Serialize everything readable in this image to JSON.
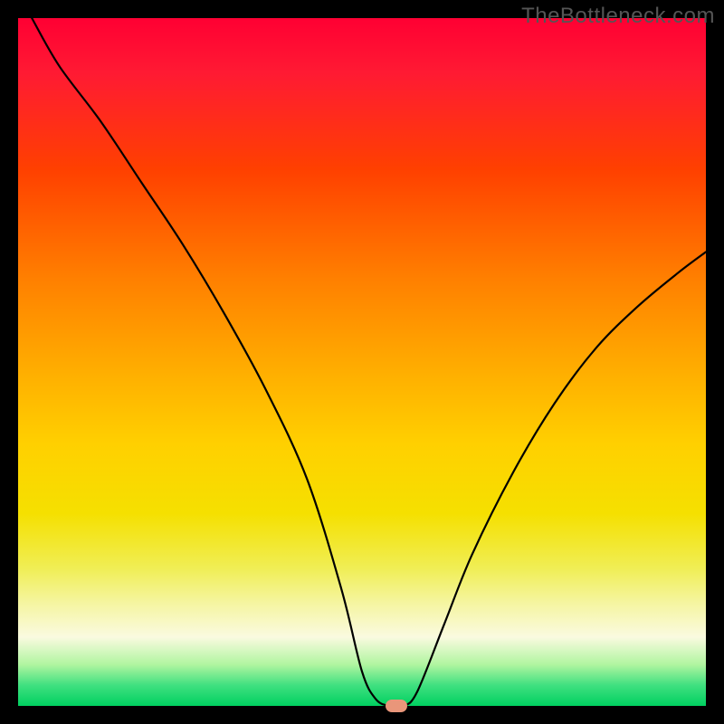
{
  "watermark": "TheBottleneck.com",
  "chart_data": {
    "type": "line",
    "title": "",
    "xlabel": "",
    "ylabel": "",
    "xlim": [
      0,
      100
    ],
    "ylim": [
      0,
      100
    ],
    "background_gradient": {
      "top": "#ff0033",
      "upper_mid": "#ff8000",
      "mid": "#ffd000",
      "lower_mid": "#f5f5a0",
      "bottom": "#00d060",
      "meaning": "top=high bottleneck, bottom=low bottleneck"
    },
    "series": [
      {
        "name": "bottleneck-curve",
        "x": [
          2,
          6,
          12,
          18,
          24,
          30,
          36,
          42,
          47,
          50,
          52,
          54,
          56,
          58,
          62,
          66,
          72,
          78,
          84,
          90,
          96,
          100
        ],
        "y": [
          100,
          93,
          85,
          76,
          67,
          57,
          46,
          33,
          17,
          5,
          1,
          0,
          0,
          2,
          12,
          22,
          34,
          44,
          52,
          58,
          63,
          66
        ]
      }
    ],
    "marker": {
      "x": 55,
      "y": 0,
      "color": "#e9967a"
    }
  }
}
